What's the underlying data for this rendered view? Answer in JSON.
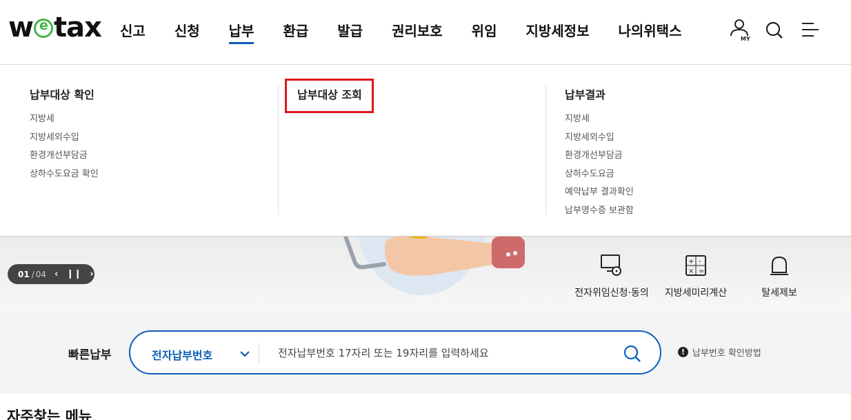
{
  "brand": {
    "logo_prefix": "w",
    "logo_e": "e",
    "logo_suffix": "tax",
    "accent": "#0b5eb8",
    "logo_green": "#43b649"
  },
  "nav": {
    "items": [
      {
        "label": "신고"
      },
      {
        "label": "신청"
      },
      {
        "label": "납부",
        "active": true
      },
      {
        "label": "환급"
      },
      {
        "label": "발급"
      },
      {
        "label": "권리보호"
      },
      {
        "label": "위임"
      },
      {
        "label": "지방세정보"
      },
      {
        "label": "나의위택스"
      }
    ],
    "my_label": "MY",
    "icons": [
      "user-my-icon",
      "search-icon",
      "hamburger-menu-icon"
    ]
  },
  "submenu": {
    "col1": {
      "title": "납부대상 확인",
      "links": [
        "지방세",
        "지방세외수입",
        "환경개선부담금",
        "상하수도요금 확인"
      ]
    },
    "col2": {
      "title": "납부대상 조회",
      "links": []
    },
    "col3": {
      "title": "납부결과",
      "links": [
        "지방세",
        "지방세외수입",
        "환경개선부담금",
        "상하수도요금",
        "예약납부 결과확인",
        "납부영수증 보관함"
      ]
    },
    "highlight_color": "#e0141e"
  },
  "slider": {
    "current": "01",
    "separator": "/",
    "total": "04",
    "prev": "‹",
    "pause": "❙❙",
    "next": "›"
  },
  "quick_links": [
    {
      "label": "전자위임신청·동의",
      "icon": "monitor-lock-icon"
    },
    {
      "label": "지방세미리계산",
      "icon": "calculator-icon"
    },
    {
      "label": "탈세제보",
      "icon": "alarm-bell-icon"
    }
  ],
  "quick_pay": {
    "label": "빠른납부",
    "select_value": "전자납부번호",
    "placeholder": "전자납부번호 17자리 또는 19자리를 입력하세요",
    "help_text": "납부번호 확인방법",
    "help_mark": "!"
  },
  "section": {
    "title": "자주찾는 메뉴"
  }
}
